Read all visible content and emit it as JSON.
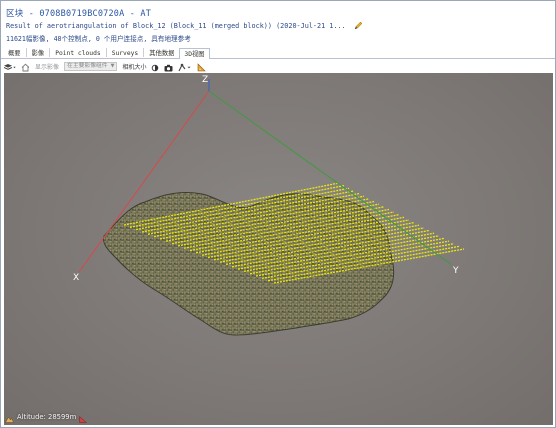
{
  "header": {
    "title": "区块 - 0708B0719BC0720A - AT",
    "subtitle": "Result of aerotriangulation of Block_12 (Block_11 (merged block)) (2020-Jul-21 1...",
    "info": "11621幅影像, 48个控制点, 0 个用户连接点, 具有地理参考"
  },
  "tabs": [
    {
      "label": "概要"
    },
    {
      "label": "影像"
    },
    {
      "label": "Point clouds"
    },
    {
      "label": "Surveys"
    },
    {
      "label": "其他数据"
    },
    {
      "label": "3D视图"
    }
  ],
  "toolbar": {
    "show_images_label": "显示影像",
    "images_select": "在主要影像组件",
    "camera_size_label": "相机大小"
  },
  "viewport": {
    "axis_x": "X",
    "axis_y": "Y",
    "axis_z": "Z",
    "colors": {
      "x_axis": "#d44a4a",
      "y_axis": "#3f9a3f",
      "z_axis": "#3f62c8",
      "cameras": "#f4f200",
      "background": "#7d7875"
    }
  },
  "status": {
    "altitude": "Altitude: 28599m"
  }
}
